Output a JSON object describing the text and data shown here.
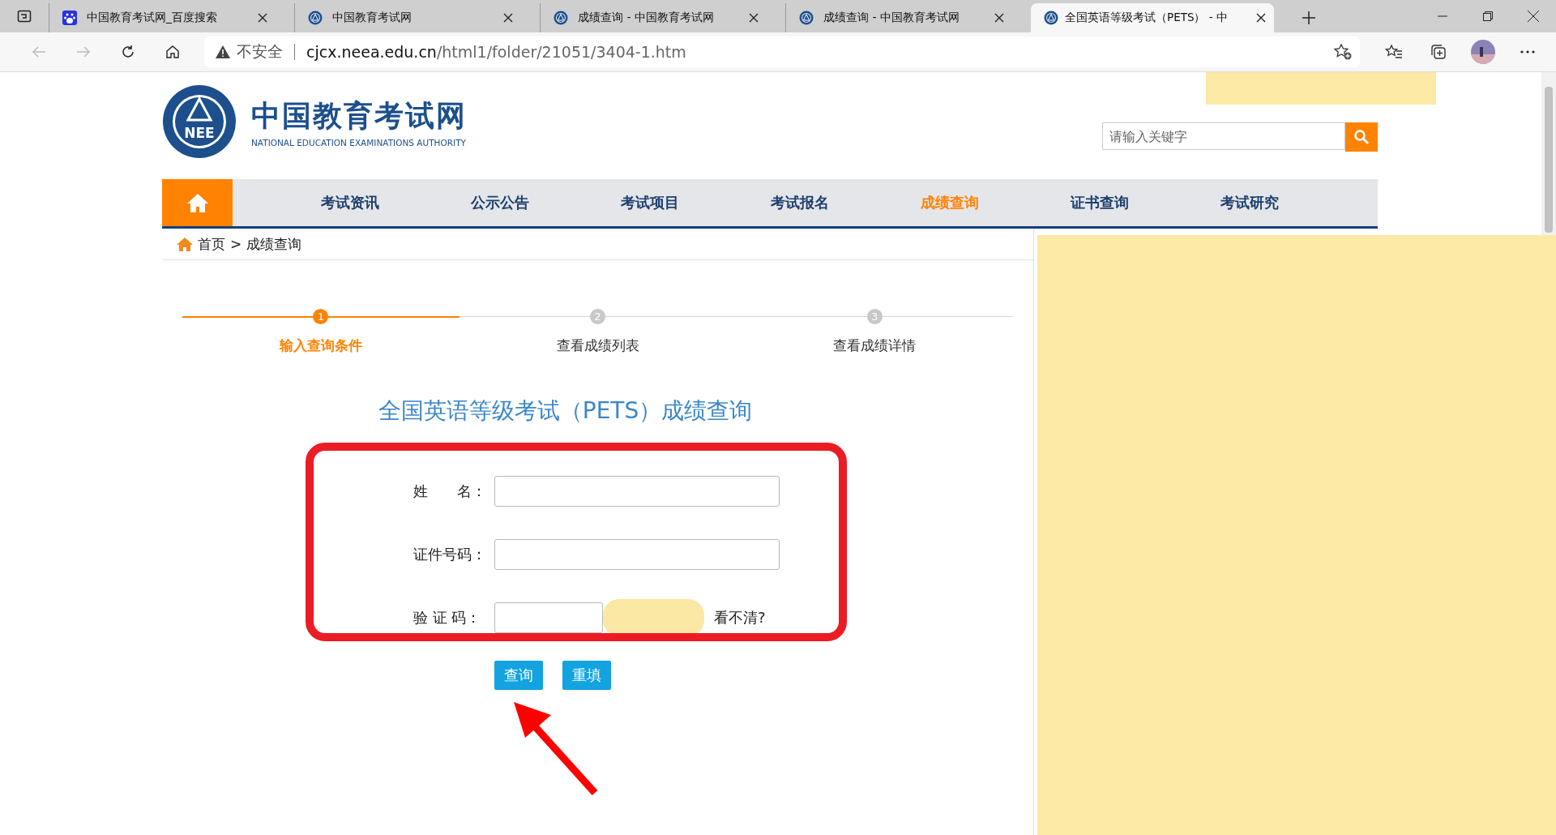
{
  "browser": {
    "tabs": [
      {
        "title": "中国教育考试网_百度搜索",
        "kind": "paw",
        "selected": false
      },
      {
        "title": "中国教育考试网",
        "kind": "emblem",
        "selected": false
      },
      {
        "title": "成绩查询 - 中国教育考试网",
        "kind": "emblem",
        "selected": false
      },
      {
        "title": "成绩查询 - 中国教育考试网",
        "kind": "emblem",
        "selected": false
      },
      {
        "title": "全国英语等级考试（PETS） - 中",
        "kind": "emblem",
        "selected": true
      }
    ],
    "address": {
      "security": "不安全",
      "host": "cjcx.neea.edu.cn",
      "path": "/html1/folder/21051/3404-1.htm"
    }
  },
  "site": {
    "logo": {
      "emblem_text": "NEE",
      "title": "中国教育考试网",
      "subtitle": "NATIONAL EDUCATION EXAMINATIONS AUTHORITY"
    },
    "search": {
      "placeholder": "请输入关键字"
    },
    "nav": [
      {
        "label": "考试资讯",
        "selected": false
      },
      {
        "label": "公示公告",
        "selected": false
      },
      {
        "label": "考试项目",
        "selected": false
      },
      {
        "label": "考试报名",
        "selected": false
      },
      {
        "label": "成绩查询",
        "selected": true
      },
      {
        "label": "证书查询",
        "selected": false
      },
      {
        "label": "考试研究",
        "selected": false
      }
    ],
    "breadcrumb": {
      "items": [
        "首页",
        "成绩查询"
      ],
      "separator": ">"
    }
  },
  "steps": [
    {
      "number": "1",
      "label": "输入查询条件",
      "selected": true
    },
    {
      "number": "2",
      "label": "查看成绩列表",
      "selected": false
    },
    {
      "number": "3",
      "label": "查看成绩详情",
      "selected": false
    }
  ],
  "form": {
    "title": "全国英语等级考试（PETS）成绩查询",
    "fields": [
      {
        "label": "姓　　名：",
        "kind": "text"
      },
      {
        "label": "证件号码：",
        "kind": "text"
      },
      {
        "label": "验 证 码：",
        "kind": "captcha",
        "link": "看不清?"
      }
    ],
    "buttons": [
      "查询",
      "重填"
    ]
  }
}
